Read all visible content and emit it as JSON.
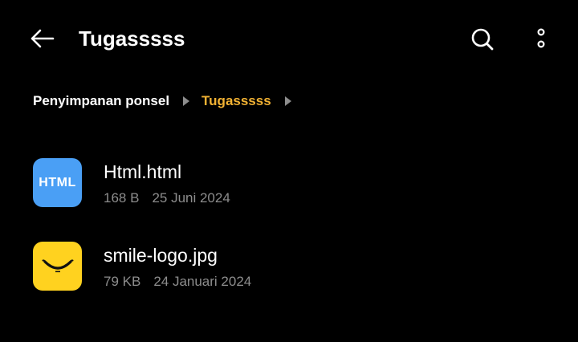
{
  "header": {
    "title": "Tugasssss",
    "back_icon": "arrow-left-icon",
    "search_icon": "search-icon",
    "more_icon": "more-vertical-icon"
  },
  "breadcrumb": {
    "items": [
      {
        "label": "Penyimpanan ponsel"
      },
      {
        "label": "Tugasssss"
      }
    ],
    "separator_icon": "triangle-right-icon"
  },
  "files": [
    {
      "name": "Html.html",
      "size": "168 B",
      "date": "25 Juni 2024",
      "icon_label": "HTML",
      "icon": "html-file-icon"
    },
    {
      "name": "smile-logo.jpg",
      "size": "79 KB",
      "date": "24 Januari 2024",
      "icon": "smile-logo-thumbnail"
    }
  ],
  "colors": {
    "background": "#000000",
    "accent": "#f2b233",
    "meta_text": "#8d8d8d",
    "html_icon_bg": "#4a9ff5",
    "image_icon_bg": "#ffd21f"
  }
}
